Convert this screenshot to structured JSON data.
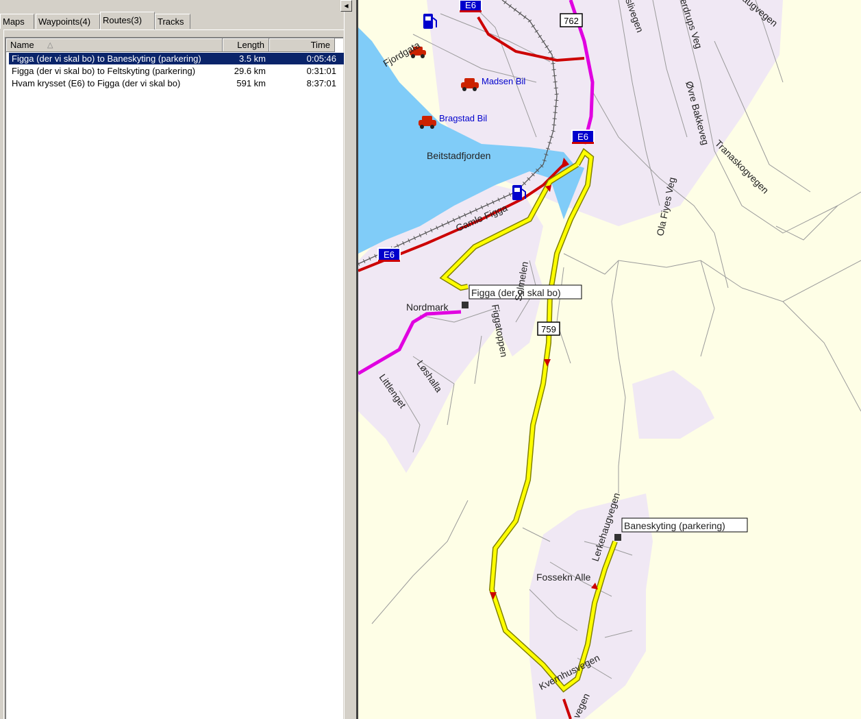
{
  "tabs": [
    {
      "label": "Maps"
    },
    {
      "label": "Waypoints(4)"
    },
    {
      "label": "Routes(3)"
    },
    {
      "label": "Tracks"
    }
  ],
  "active_tab": "Routes(3)",
  "columns": {
    "name": "Name",
    "length": "Length",
    "time": "Time",
    "sort_indicator": "△"
  },
  "routes": [
    {
      "name": "Figga (der vi skal bo) to Baneskyting (parkering)",
      "length": "3.5 km",
      "time": "0:05:46",
      "selected": true
    },
    {
      "name": "Figga (der vi skal bo) to Feltskyting (parkering)",
      "length": "29.6 km",
      "time": "0:31:01",
      "selected": false
    },
    {
      "name": "Hvam krysset (E6) to Figga (der vi skal bo)",
      "length": "591 km",
      "time": "8:37:01",
      "selected": false
    }
  ],
  "scroll_arrow": "◀",
  "map": {
    "shields": {
      "e6_top": "E6",
      "r762": "762",
      "e6_mid": "E6",
      "e6_left": "E6",
      "r759": "759"
    },
    "waypoints": {
      "figga": "Figga (der vi skal bo)",
      "baneskyting": "Baneskyting (parkering)"
    },
    "places": {
      "nordmark": "Nordmark",
      "beitstadfjorden": "Beitstadfjorden",
      "fossekn": "Fossekn Alle"
    },
    "pois": {
      "madsen": "Madsen Bil",
      "bragstad": "Bragstad Bil"
    },
    "streets": {
      "fjordgata": "Fjordgata",
      "gamle_figga": "Gamle Figga",
      "solmelen": "Solmelen",
      "figgatoppen": "Figgatoppen",
      "loshalla": "Løshalla",
      "littlenget": "Littlenget",
      "ovre_bakkeveg": "Øvre Bakkeveg",
      "ola_fiyes_veg": "Ola Fiyes Veg",
      "tranaskogvegen": "Tranaskogvegen",
      "lerkehaugvegen": "Lerkehaugvegen",
      "kvernhusvegen": "Kvernhusvegen",
      "slivegen": "slivegen",
      "erdrups_veg": "erdrups Veg",
      "augvegen": "augvegen",
      "vegen_bottom": "vegen"
    },
    "colors": {
      "water": "#80ccf8",
      "land": "#fefee6",
      "urban": "#f0e8f4",
      "route": "#ffff00",
      "e6_road": "#cc0000",
      "r762_road": "#e000e0"
    }
  }
}
